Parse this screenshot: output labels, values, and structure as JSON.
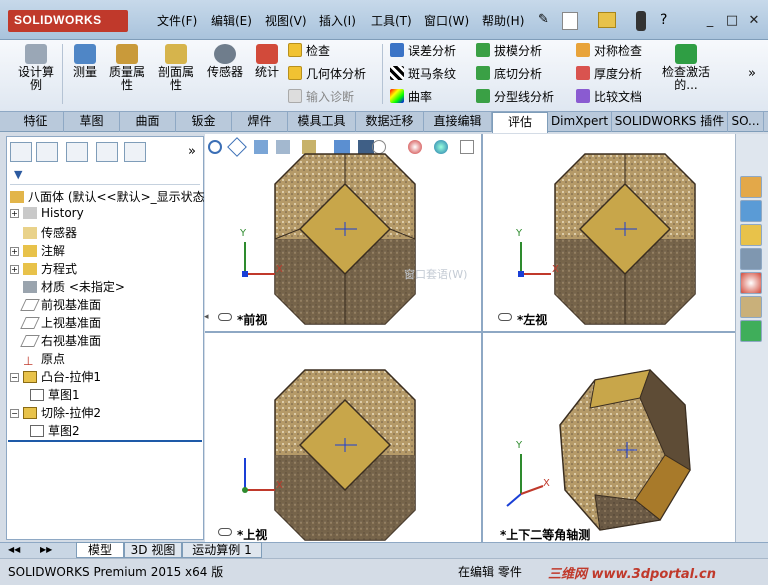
{
  "app": {
    "logo": "SOLIDWORKS"
  },
  "menu": [
    "文件(F)",
    "编辑(E)",
    "视图(V)",
    "插入(I)",
    "工具(T)",
    "窗口(W)",
    "帮助(H)"
  ],
  "window_buttons": [
    "_",
    "□",
    "✕"
  ],
  "ribbon": {
    "big": [
      "设计算例",
      "测量",
      "质量属性",
      "剖面属性",
      "传感器",
      "统计"
    ],
    "col1": [
      "检查",
      "几何体分析",
      "输入诊断"
    ],
    "col2": [
      "误差分析",
      "斑马条纹",
      "曲率"
    ],
    "col3": [
      "拔模分析",
      "底切分析",
      "分型线分析"
    ],
    "col4": [
      "对称检查",
      "厚度分析",
      "比较文档"
    ],
    "last": "检查激活的...",
    "more": "»"
  },
  "tabs": [
    "特征",
    "草图",
    "曲面",
    "钣金",
    "焊件",
    "模具工具",
    "数据迁移",
    "直接编辑",
    "评估",
    "DimXpert",
    "SOLIDWORKS 插件",
    "SO..."
  ],
  "active_tab": "评估",
  "tree": {
    "root": "八面体 (默认<<默认>_显示状态",
    "items": [
      "History",
      "传感器",
      "注解",
      "方程式",
      "材质 <未指定>",
      "前视基准面",
      "上视基准面",
      "右视基准面",
      "原点",
      "凸台-拉伸1",
      "草图1",
      "切除-拉伸2",
      "草图2"
    ]
  },
  "views": [
    "*前视",
    "*左视",
    "*上视",
    "*上下二等角轴测"
  ],
  "axis": {
    "x": "X",
    "y": "Y"
  },
  "ghost_text": "窗口套语(W)",
  "bottom_tabs": [
    "模型",
    "3D 视图",
    "运动算例 1"
  ],
  "status": {
    "left": "SOLIDWORKS Premium 2015 x64 版",
    "mid": "在编辑 零件",
    "watermark": "三维网 www.3dportal.cn"
  },
  "colors": {
    "accent": "#c0392b",
    "faceTop": "#c8a64a",
    "faceDark": "#6b5a45",
    "faceTan": "#b59a68"
  }
}
